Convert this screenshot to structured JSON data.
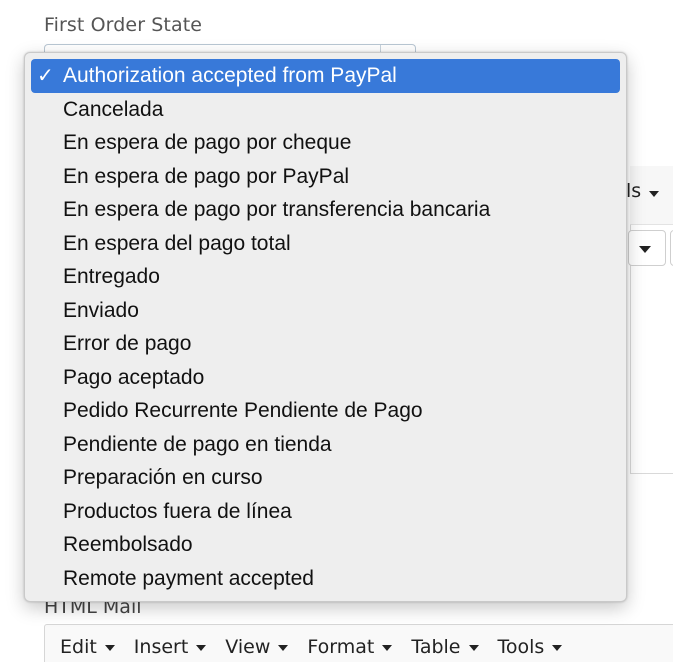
{
  "field": {
    "label": "First Order State"
  },
  "dropdown": {
    "selected_index": 0,
    "check_glyph": "✓",
    "options": [
      "Authorization accepted from PayPal",
      "Cancelada",
      "En espera de pago por cheque",
      "En espera de pago por PayPal",
      "En espera de pago por transferencia bancaria",
      "En espera del pago total",
      "Entregado",
      "Enviado",
      "Error de pago",
      "Pago aceptado",
      "Pedido Recurrente Pendiente de Pago",
      "Pendiente de pago en tienda",
      "Preparación en curso",
      "Productos fuera de línea",
      "Reembolsado",
      "Remote payment accepted"
    ],
    "highlight_color": "#3879d9"
  },
  "background_editor": {
    "tools_fragment": "ls"
  },
  "html_mail": {
    "label": "HTML Mail",
    "menu": [
      "Edit",
      "Insert",
      "View",
      "Format",
      "Table",
      "Tools"
    ]
  },
  "icons": {
    "checkmark": "check-icon",
    "dropdown_caret": "chevron-down-icon"
  }
}
